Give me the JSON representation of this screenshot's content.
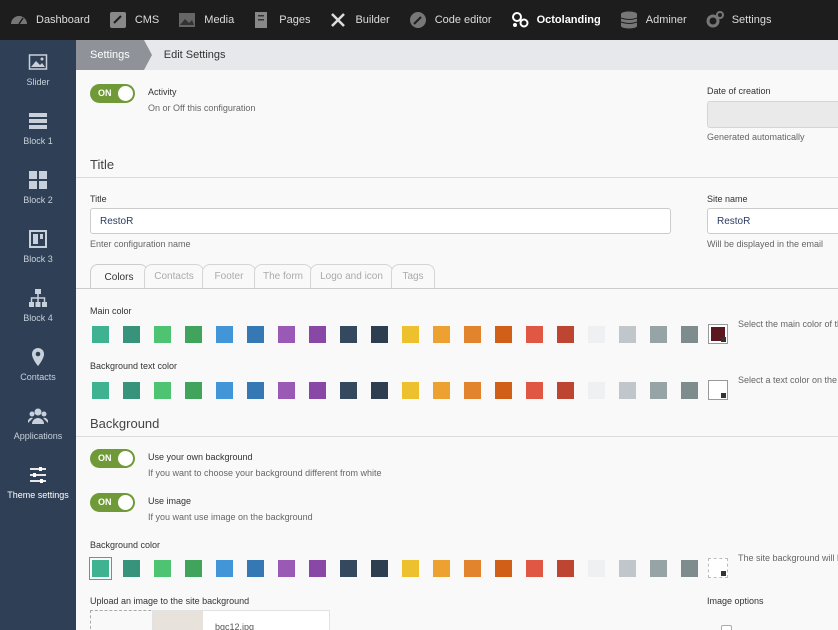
{
  "topnav": {
    "items": [
      {
        "label": "Dashboard",
        "icon": "dashboard-icon"
      },
      {
        "label": "CMS",
        "icon": "cms-icon"
      },
      {
        "label": "Media",
        "icon": "media-icon"
      },
      {
        "label": "Pages",
        "icon": "pages-icon"
      },
      {
        "label": "Builder",
        "icon": "builder-icon"
      },
      {
        "label": "Code editor",
        "icon": "code-editor-icon"
      },
      {
        "label": "Octolanding",
        "icon": "octolanding-icon",
        "active": true
      },
      {
        "label": "Adminer",
        "icon": "adminer-icon"
      },
      {
        "label": "Settings",
        "icon": "settings-icon"
      }
    ]
  },
  "sidebar": {
    "items": [
      {
        "label": "Slider",
        "icon": "image-icon"
      },
      {
        "label": "Block 1",
        "icon": "block1-icon"
      },
      {
        "label": "Block 2",
        "icon": "block2-icon"
      },
      {
        "label": "Block 3",
        "icon": "block3-icon"
      },
      {
        "label": "Block 4",
        "icon": "block4-icon"
      },
      {
        "label": "Contacts",
        "icon": "map-pin-icon"
      },
      {
        "label": "Applications",
        "icon": "users-icon"
      },
      {
        "label": "Theme settings",
        "icon": "sliders-icon",
        "active": true
      }
    ]
  },
  "breadcrumb": {
    "first": "Settings",
    "second": "Edit Settings"
  },
  "activity": {
    "toggle": "ON",
    "label": "Activity",
    "help": "On or Off this configuration"
  },
  "date_of_creation": {
    "label": "Date of creation",
    "value": "",
    "help": "Generated automatically"
  },
  "title_section": {
    "heading": "Title"
  },
  "title_field": {
    "label": "Title",
    "value": "RestoR",
    "help": "Enter configuration name"
  },
  "site_name_field": {
    "label": "Site name",
    "value": "RestoR",
    "help": "Will be displayed in the email"
  },
  "tabs": [
    {
      "label": "Colors",
      "active": true
    },
    {
      "label": "Contacts"
    },
    {
      "label": "Footer"
    },
    {
      "label": "The form"
    },
    {
      "label": "Logo and icon"
    },
    {
      "label": "Tags"
    }
  ],
  "palette": [
    "#3fb391",
    "#37947a",
    "#4ec472",
    "#41a45c",
    "#4295d6",
    "#3678b4",
    "#9b59b6",
    "#8a48a6",
    "#34495e",
    "#2d3e50",
    "#ecc12d",
    "#eca131",
    "#e2832e",
    "#d25f18",
    "#e05744",
    "#bd4532",
    "#eef0f1",
    "#c0c6ca",
    "#97a4a6",
    "#7f8c8d"
  ],
  "main_color": {
    "label": "Main color",
    "help": "Select the main color of th",
    "value": "#5c1720"
  },
  "bg_text_color": {
    "label": "Background text color",
    "help": "Select a text color on the",
    "value": "#ffffff"
  },
  "background_section": {
    "heading": "Background"
  },
  "own_background": {
    "toggle": "ON",
    "label": "Use your own background",
    "help": "If you want to choose your background different from white"
  },
  "use_image": {
    "toggle": "ON",
    "label": "Use image",
    "help": "If you want use image on the background"
  },
  "bg_color": {
    "label": "Background color",
    "help": "The site background will b",
    "value": "#ffffff"
  },
  "upload": {
    "label": "Upload an image to the site background",
    "filename": "bgc12.jpg"
  },
  "image_options": {
    "label": "Image options"
  }
}
